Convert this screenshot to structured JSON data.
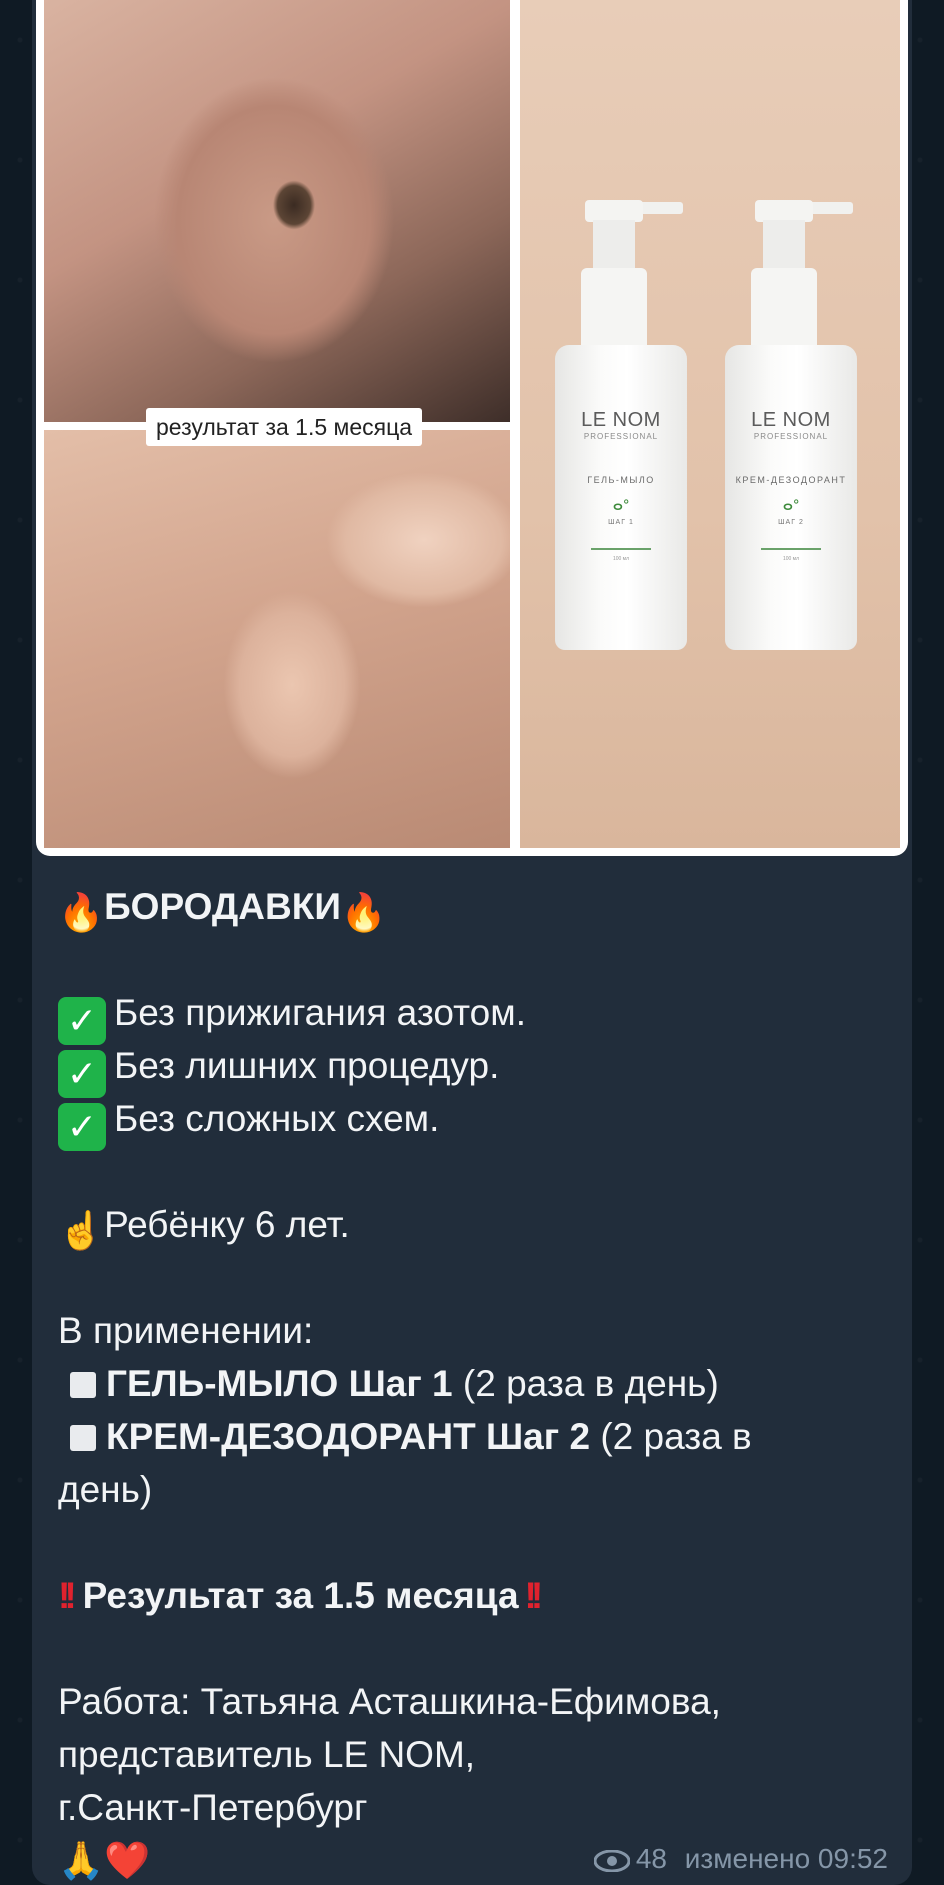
{
  "media": {
    "photo_label": "результат за 1.5 месяца",
    "bottles": [
      {
        "brand": "LE NOM",
        "brand_sub": "PROFESSIONAL",
        "product": "ГЕЛЬ-МЫЛО",
        "step": "ШАГ 1",
        "volume": "100 мл"
      },
      {
        "brand": "LE NOM",
        "brand_sub": "PROFESSIONAL",
        "product": "КРЕМ-ДЕЗОДОРАНТ",
        "step": "ШАГ 2",
        "volume": "100 мл"
      }
    ]
  },
  "post": {
    "title": "БОРОДАВКИ",
    "title_emoji": "🔥",
    "benefits": [
      "Без прижигания азотом.",
      "Без лишних процедур.",
      "Без сложных схем."
    ],
    "child_emoji": "☝️",
    "child_text": "Ребёнку 6 лет.",
    "usage_heading": "В применении:",
    "usage": [
      {
        "name": "ГЕЛЬ-МЫЛО Шаг 1",
        "note": "(2 раза в день)"
      },
      {
        "name": "КРЕМ-ДЕЗОДОРАНТ Шаг 2",
        "note": "(2 раза в",
        "note_cont": "день)"
      }
    ],
    "result": "Результат за 1.5 месяца",
    "credit_1": "Работа: Татьяна Асташкина-Ефимова,",
    "credit_2": "представитель LE NOM,",
    "credit_3": "г.Санкт-Петербург",
    "closing_emojis": "🙏❤️"
  },
  "meta": {
    "views": "48",
    "edited": "изменено 09:52"
  },
  "colors": {
    "chat_bg": "#0f1a24",
    "bubble_bg": "#212d3b",
    "text": "#f2f4f6",
    "meta": "#8596a8",
    "check": "#1fb34a",
    "excl": "#e0222e"
  }
}
